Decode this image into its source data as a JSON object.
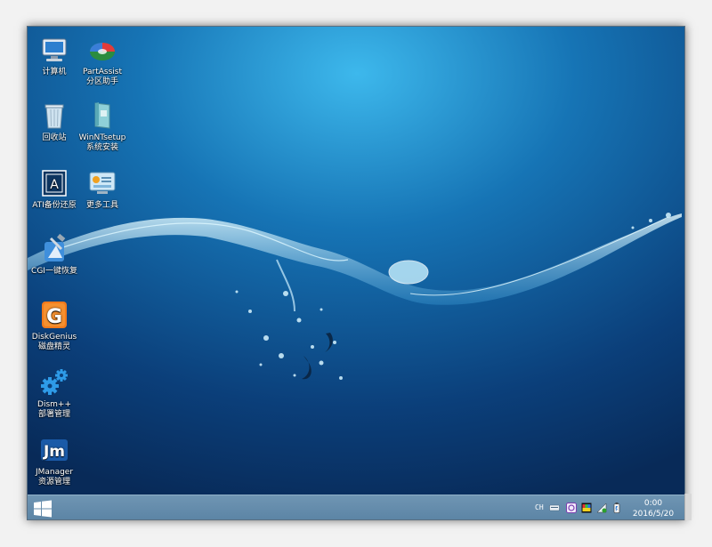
{
  "desktop": {
    "icons": [
      {
        "label": "计算机",
        "sub": "",
        "icon": "computer-icon"
      },
      {
        "label": "PartAssist",
        "sub": "分区助手",
        "icon": "partassist-icon"
      },
      {
        "label": "回收站",
        "sub": "",
        "icon": "recycle-bin-icon"
      },
      {
        "label": "WinNTsetup",
        "sub": "系统安装",
        "icon": "winntsetup-icon"
      },
      {
        "label": "ATI备份还原",
        "sub": "",
        "icon": "ati-backup-icon"
      },
      {
        "label": "更多工具",
        "sub": "",
        "icon": "more-tools-icon"
      },
      {
        "label": "CGI一键恢复",
        "sub": "",
        "icon": "cgi-restore-icon"
      },
      {
        "label": "DiskGenius",
        "sub": "磁盘精灵",
        "icon": "diskgenius-icon"
      },
      {
        "label": "Dism++",
        "sub": "部署管理",
        "icon": "dism-gear-icon"
      },
      {
        "label": "JManager",
        "sub": "资源管理",
        "icon": "jmanager-icon"
      }
    ]
  },
  "taskbar": {
    "language": "CH",
    "time": "0:00",
    "date": "2016/5/20",
    "tray_icons": [
      "keyboard-icon",
      "input-method-icon",
      "display-icon",
      "network-icon",
      "power-icon"
    ]
  },
  "colors": {
    "wallpaper_center": "#2a9fd6",
    "wallpaper_edge": "#0a2a55",
    "taskbar": "#6489a8"
  }
}
